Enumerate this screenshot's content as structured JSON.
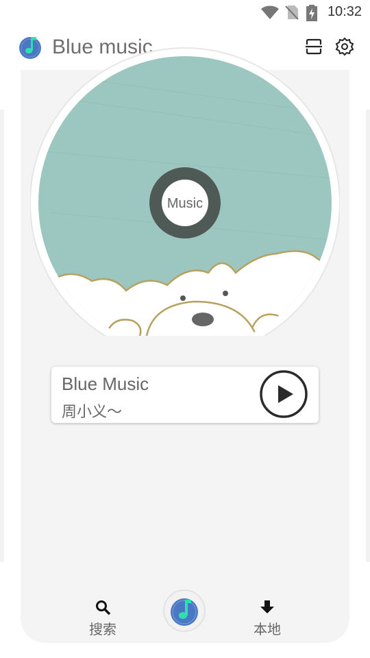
{
  "status_bar": {
    "time": "10:32",
    "icons": [
      "wifi-icon",
      "no-sim-icon",
      "battery-charging-icon"
    ]
  },
  "app_bar": {
    "title": "Blue music",
    "logo_icon": "music-note-logo-icon",
    "actions": [
      "scan-icon",
      "settings-gear-icon"
    ]
  },
  "disc": {
    "label": "Music"
  },
  "now_playing": {
    "title": "Blue Music",
    "artist": "周小义～",
    "button_icon": "play-icon"
  },
  "bottom_nav": {
    "items": [
      {
        "label": "搜索",
        "icon": "search-icon"
      },
      {
        "label": "",
        "icon": "music-note-center-icon"
      },
      {
        "label": "本地",
        "icon": "download-arrow-icon"
      }
    ]
  },
  "colors": {
    "disc_teal": "#9cc7c0",
    "accent_blue": "#4a78c2",
    "accent_green": "#2ee0b0",
    "card_bg": "#f4f4f4"
  }
}
